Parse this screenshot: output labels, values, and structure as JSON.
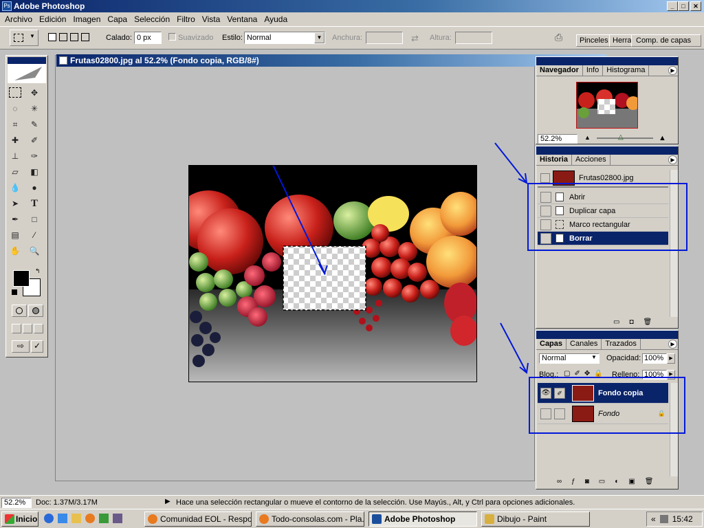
{
  "window": {
    "title": "Adobe Photoshop",
    "btn_min": "_",
    "btn_max": "□",
    "btn_close": "✕"
  },
  "menu": [
    "Archivo",
    "Edición",
    "Imagen",
    "Capa",
    "Selección",
    "Filtro",
    "Vista",
    "Ventana",
    "Ayuda"
  ],
  "options": {
    "calado_label": "Calado:",
    "calado_value": "0 px",
    "suavizado_label": "Suavizado",
    "estilo_label": "Estilo:",
    "estilo_value": "Normal",
    "anchura_label": "Anchura:",
    "altura_label": "Altura:",
    "well_tabs": [
      "Pinceles",
      "Herramientas",
      "Comp. de capas"
    ]
  },
  "document": {
    "title": "Frutas02800.jpg al 52.2% (Fondo copia, RGB/8#)"
  },
  "navigator": {
    "tabs": [
      "Navegador",
      "Info",
      "Histograma"
    ],
    "zoom": "52.2%"
  },
  "history": {
    "tabs": [
      "Historia",
      "Acciones"
    ],
    "snapshot": "Frutas02800.jpg",
    "steps": [
      "Abrir",
      "Duplicar capa",
      "Marco rectangular",
      "Borrar"
    ]
  },
  "layers": {
    "tabs": [
      "Capas",
      "Canales",
      "Trazados"
    ],
    "blend": "Normal",
    "opacity_label": "Opacidad:",
    "opacity": "100%",
    "lock_label": "Bloq.:",
    "fill_label": "Relleno:",
    "fill": "100%",
    "items": [
      "Fondo copia",
      "Fondo"
    ]
  },
  "status": {
    "zoom": "52.2%",
    "doc": "Doc: 1.37M/3.17M",
    "hint": "Hace una selección rectangular o mueve el contorno de la selección. Use Mayús., Alt, y Ctrl para opciones adicionales."
  },
  "taskbar": {
    "start": "Inicio",
    "tasks": [
      "Comunidad EOL - Respo...",
      "Todo-consolas.com - Pla...",
      "Adobe Photoshop",
      "Dibujo - Paint"
    ],
    "clock": "15:42",
    "tray_arrows": "«"
  },
  "colors": {
    "annotation": "#0018d8",
    "selection": "#0a246a",
    "titlebar": "#0a246a"
  }
}
